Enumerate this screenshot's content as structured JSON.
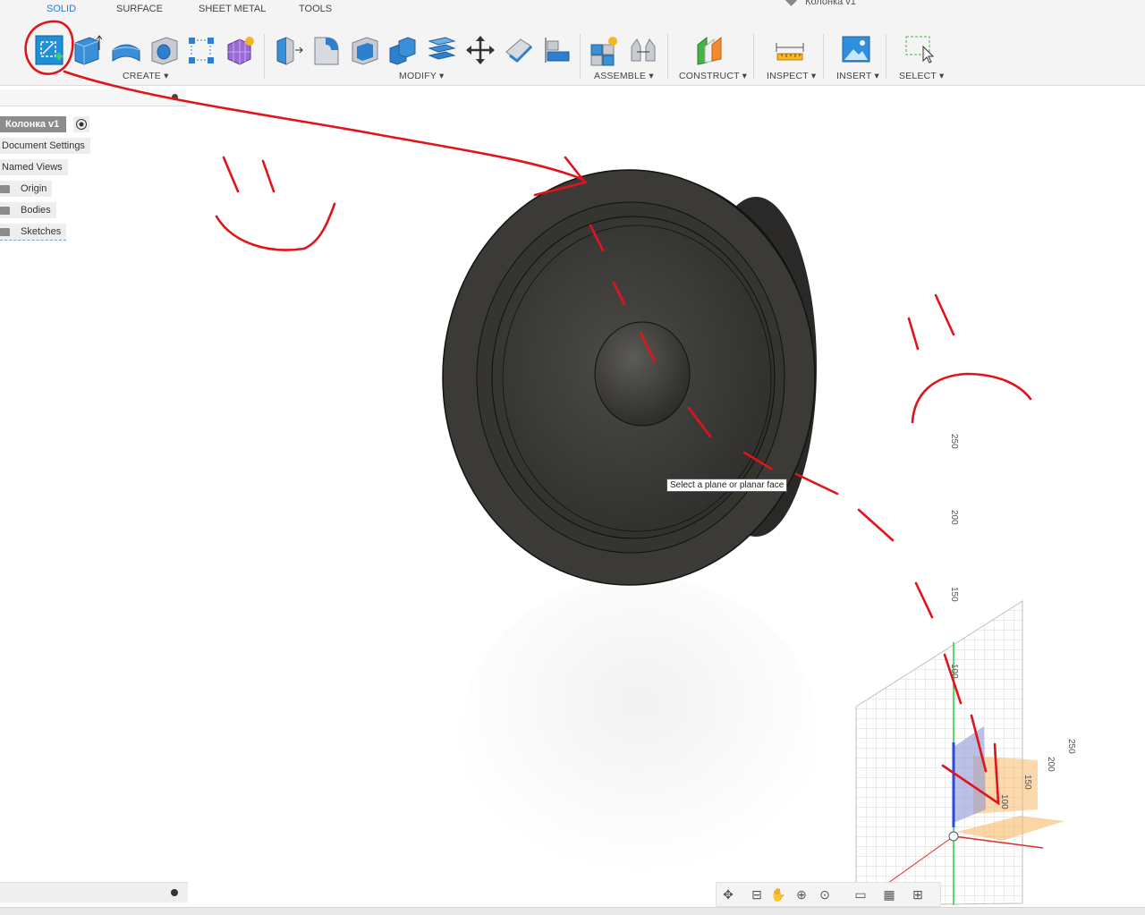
{
  "app": {
    "document_title": "Колонка v1",
    "tabs": [
      {
        "label": "SOLID",
        "active": true
      },
      {
        "label": "SURFACE"
      },
      {
        "label": "SHEET METAL"
      },
      {
        "label": "TOOLS"
      }
    ]
  },
  "toolbar": {
    "groups": [
      {
        "label": "CREATE ▾",
        "tools": [
          "create-sketch-icon",
          "extrude-icon",
          "revolve-icon",
          "hole-icon",
          "pattern-icon",
          "create-form-icon"
        ]
      },
      {
        "label": "MODIFY ▾",
        "tools": [
          "press-pull-icon",
          "fillet-icon",
          "shell-icon",
          "combine-icon",
          "split-body-icon",
          "move-icon",
          "offset-face-icon",
          "align-icon"
        ]
      },
      {
        "label": "ASSEMBLE ▾",
        "tools": [
          "new-component-icon",
          "joint-icon"
        ]
      },
      {
        "label": "CONSTRUCT ▾",
        "tools": [
          "offset-plane-icon"
        ]
      },
      {
        "label": "INSPECT ▾",
        "tools": [
          "measure-icon"
        ]
      },
      {
        "label": "INSERT ▾",
        "tools": [
          "insert-image-icon"
        ]
      },
      {
        "label": "SELECT ▾",
        "tools": [
          "select-icon"
        ]
      }
    ]
  },
  "browser": {
    "root": "Колонка v1",
    "items": [
      {
        "label": "Document Settings"
      },
      {
        "label": "Named Views"
      },
      {
        "label": "Origin",
        "folder": true
      },
      {
        "label": "Bodies",
        "folder": true
      },
      {
        "label": "Sketches",
        "folder": true
      }
    ]
  },
  "viewport": {
    "tooltip": "Select a plane or planar face",
    "grid_labels": [
      "250",
      "200",
      "150",
      "100",
      "250",
      "200",
      "150",
      "100"
    ]
  },
  "colors": {
    "accent": "#2a7ad1",
    "annotation": "#e0141a",
    "speaker": "#3a3936",
    "plane_orange": "#f7b96a",
    "plane_blue": "#8f96d6"
  }
}
